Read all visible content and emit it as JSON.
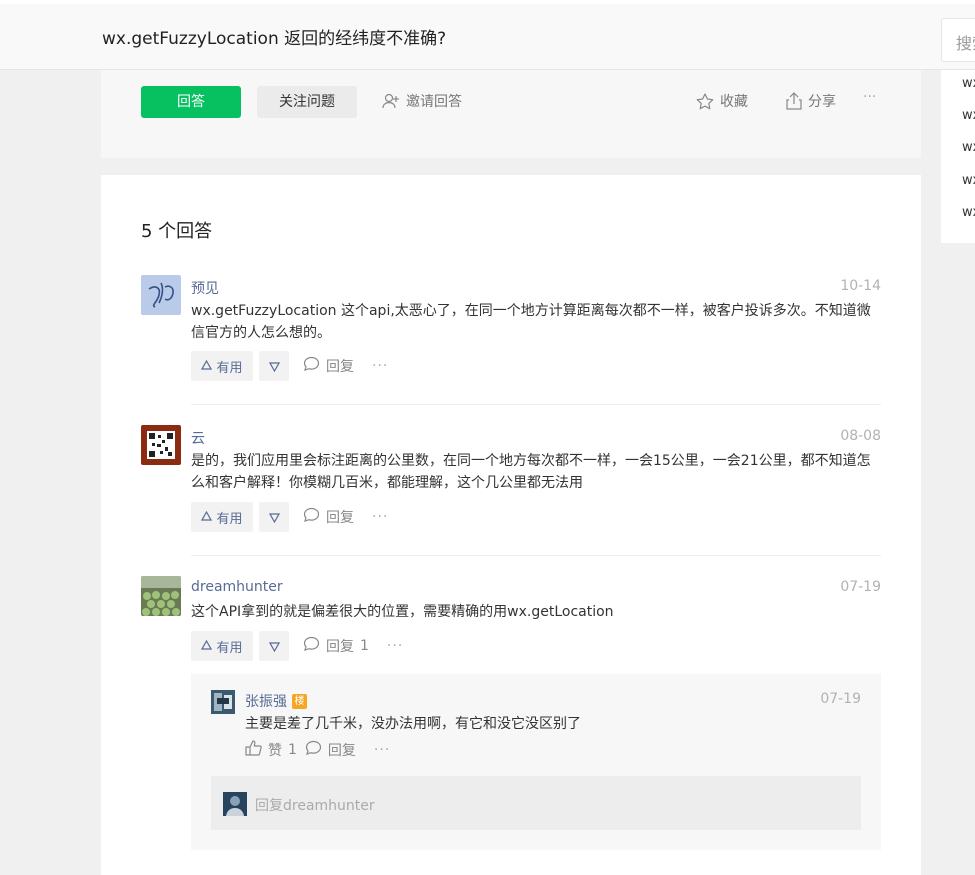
{
  "header": {
    "title": "wx.getFuzzyLocation 返回的经纬度不准确?",
    "search_placeholder": "搜索"
  },
  "actions": {
    "answer": "回答",
    "follow": "关注问题",
    "invite": "邀请回答",
    "favorite": "收藏",
    "share": "分享",
    "more": "···"
  },
  "sidebar": {
    "links": [
      "wx",
      "wx",
      "wx",
      "wx",
      "wx"
    ]
  },
  "answers": {
    "count_label": "5 个回答",
    "useful_label": "有用",
    "reply_label": "回复",
    "more": "···",
    "items": [
      {
        "name": "预见",
        "date": "10-14",
        "content": "wx.getFuzzyLocation 这个api,太恶心了，在同一个地方计算距离每次都不一样，被客户投诉多次。不知道微信官方的人怎么想的。",
        "reply_count": ""
      },
      {
        "name": "云",
        "date": "08-08",
        "content": "是的，我们应用里会标注距离的公里数，在同一个地方每次都不一样，一会15公里，一会21公里，都不知道怎么和客户解释！你模糊几百米，都能理解，这个几公里都无法用",
        "reply_count": ""
      },
      {
        "name": "dreamhunter",
        "date": "07-19",
        "content": "这个API拿到的就是偏差很大的位置，需要精确的用wx.getLocation",
        "reply_count": "1"
      }
    ],
    "comment": {
      "name": "张振强",
      "badge": "楼",
      "date": "07-19",
      "content": "主要是差了几千米，没办法用啊，有它和没它没区别了",
      "like_label": "赞",
      "like_count": "1",
      "reply_label": "回复",
      "more": "···",
      "reply_placeholder": "回复dreamhunter"
    }
  },
  "colors": {
    "primary": "#07c160",
    "link": "#576b95",
    "muted": "#b2b2b2"
  }
}
